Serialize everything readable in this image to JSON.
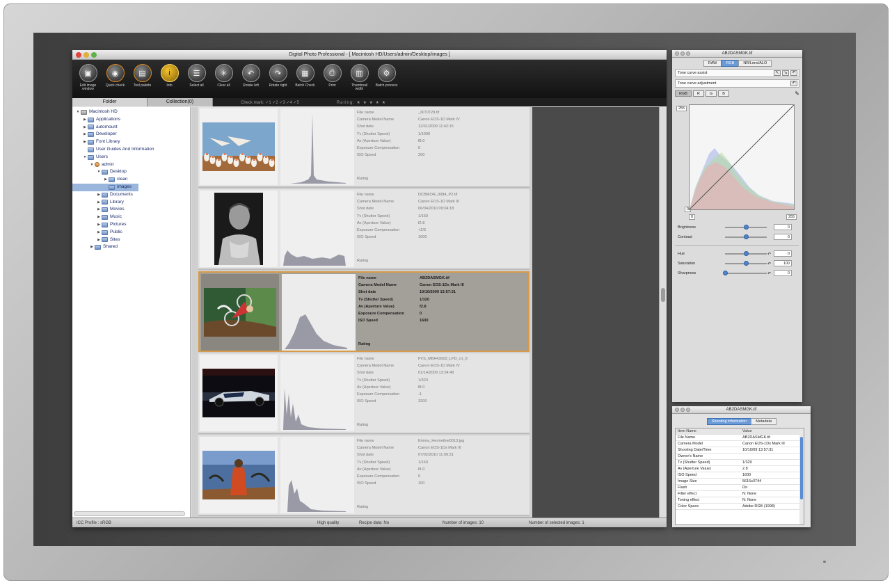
{
  "window": {
    "title": "Digital Photo Professional - [ Macintosh HD/Users/admin/Desktop/images ]"
  },
  "toolbar": [
    {
      "label": "Edit image window",
      "icon": "edit-window-icon",
      "glyph": "▣"
    },
    {
      "label": "Quick check",
      "icon": "quick-check-icon",
      "glyph": "◉"
    },
    {
      "label": "Tool palette",
      "icon": "tool-palette-icon",
      "glyph": "▤"
    },
    {
      "label": "Info",
      "icon": "info-icon",
      "glyph": "i"
    },
    {
      "label": "Select all",
      "icon": "select-all-icon",
      "glyph": "☰"
    },
    {
      "label": "Clear all",
      "icon": "clear-all-icon",
      "glyph": "✳"
    },
    {
      "label": "Rotate left",
      "icon": "rotate-left-icon",
      "glyph": "↶"
    },
    {
      "label": "Rotate right",
      "icon": "rotate-right-icon",
      "glyph": "↷"
    },
    {
      "label": "Batch Check",
      "icon": "batch-check-icon",
      "glyph": "▦"
    },
    {
      "label": "Print",
      "icon": "print-icon",
      "glyph": "⎙"
    },
    {
      "label": "Thumbnail width",
      "icon": "thumbnail-icon",
      "glyph": "▥"
    },
    {
      "label": "Batch process",
      "icon": "batch-process-icon",
      "glyph": "⚙"
    }
  ],
  "tabs": {
    "folder": "Folder",
    "collection": "Collection(0)"
  },
  "filter_bar": {
    "check_mark": "Check mark: ✓1 ✓2 ✓3 ✓4 ✓5",
    "rating": "Rating: ★ ★ ★ ★ ★"
  },
  "tree": [
    {
      "label": "Macintosh HD",
      "depth": 0,
      "kind": "hd",
      "open": true
    },
    {
      "label": "Applications",
      "depth": 1,
      "kind": "folder",
      "open": false
    },
    {
      "label": "automount",
      "depth": 1,
      "kind": "folder",
      "open": false
    },
    {
      "label": "Developer",
      "depth": 1,
      "kind": "folder",
      "open": false
    },
    {
      "label": "Font Library",
      "depth": 1,
      "kind": "folder",
      "open": false
    },
    {
      "label": "User Guides And Information",
      "depth": 1,
      "kind": "folder",
      "open": null
    },
    {
      "label": "Users",
      "depth": 1,
      "kind": "folder",
      "open": true
    },
    {
      "label": "admin",
      "depth": 2,
      "kind": "user",
      "open": true
    },
    {
      "label": "Desktop",
      "depth": 3,
      "kind": "folder",
      "open": true
    },
    {
      "label": "clean",
      "depth": 4,
      "kind": "folder",
      "open": false
    },
    {
      "label": "images",
      "depth": 4,
      "kind": "folder",
      "open": null,
      "selected": true
    },
    {
      "label": "Documents",
      "depth": 3,
      "kind": "folder",
      "open": false
    },
    {
      "label": "Library",
      "depth": 3,
      "kind": "folder",
      "open": false
    },
    {
      "label": "Movies",
      "depth": 3,
      "kind": "folder",
      "open": false
    },
    {
      "label": "Music",
      "depth": 3,
      "kind": "folder",
      "open": false
    },
    {
      "label": "Pictures",
      "depth": 3,
      "kind": "folder",
      "open": false
    },
    {
      "label": "Public",
      "depth": 3,
      "kind": "folder",
      "open": false
    },
    {
      "label": "Sites",
      "depth": 3,
      "kind": "folder",
      "open": false
    },
    {
      "label": "Shared",
      "depth": 2,
      "kind": "folder",
      "open": false
    }
  ],
  "info_keys": [
    "File name",
    "Camera Model Name",
    "Shot date",
    "Tv (Shutter Speed)",
    "Av (Aperture Value)",
    "Exposure Compensation",
    "ISO Speed"
  ],
  "rating_label": "Rating",
  "images": [
    {
      "values": [
        "_IKT0729.tif",
        "Canon EOS-1D Mark IV",
        "12/31/2009 11:42:15",
        "1/1000",
        "f8.0",
        "0",
        "200"
      ],
      "thumb": "birds",
      "hist": "spike",
      "selected": false
    },
    {
      "values": [
        "DCBMOR_0084_P2.tif",
        "Canon EOS-1D Mark III",
        "06/04/2010 09:04:18",
        "1/160",
        "f2.8",
        "+2/3",
        "1000"
      ],
      "thumb": "portrait",
      "hist": "low",
      "selected": false
    },
    {
      "values": [
        "AB2DASMGK.tif",
        "Canon EOS-1Ds Mark III",
        "10/10/2009 13:57:31",
        "1/320",
        "f2.8",
        "0",
        "1600"
      ],
      "thumb": "cyclist",
      "hist": "bump",
      "selected": true
    },
    {
      "values": [
        "FVS_MBA43003_LPD_v1_8",
        "Canon EOS-1D Mark IV",
        "01/14/2009 13:24:48",
        "1/320",
        "f8.0",
        "-1",
        "3200"
      ],
      "thumb": "racecar",
      "hist": "multi",
      "selected": false
    },
    {
      "values": [
        "Emma_Hermeline0013.jpg",
        "Canon EOS-1Ds Mark III",
        "07/02/2010 11:09:31",
        "1/160",
        "f4.0",
        "0",
        "100"
      ],
      "thumb": "person",
      "hist": "decay",
      "selected": false
    }
  ],
  "status": {
    "profile": "ICC Profile : sRGB",
    "quality": "High quality",
    "recipe": "Recipe data: No",
    "count": "Number of images: 10",
    "selected": "Number of selected images: 1"
  },
  "rgb_palette": {
    "title": "AB2DASMGK.tif",
    "tabs": [
      "RAW",
      "RGB",
      "NR/Lens/ALO"
    ],
    "active_tab": 1,
    "tone_curve": "Tone curve assist",
    "tone_adj": "Tone curve adjustment",
    "channels": [
      "RGB",
      "R",
      "G",
      "B"
    ],
    "curve_max": "255",
    "curve_min": "0",
    "in_min": "0",
    "in_max": "255",
    "sliders": [
      {
        "label": "Brightness",
        "value": "0",
        "level": 0.5,
        "group": 1
      },
      {
        "label": "Contrast",
        "value": "0",
        "level": 0.5,
        "group": 1
      },
      {
        "label": "Hue",
        "value": "0",
        "level": 0.5,
        "group": 2
      },
      {
        "label": "Saturation",
        "value": "100",
        "level": 0.5,
        "group": 2
      },
      {
        "label": "Sharpness",
        "value": "0",
        "level": 0.0,
        "group": 2
      }
    ]
  },
  "info_palette": {
    "title": "AB2DASMGK.tif",
    "tabs": [
      "Shooting information",
      "Metadata"
    ],
    "columns": [
      "Item Name",
      "Value"
    ],
    "rows": [
      [
        "File Name",
        "AB2DASMGK.tif"
      ],
      [
        "Camera Model",
        "Canon EOS-1Ds Mark III"
      ],
      [
        "Shooting Date/Time",
        "10/10/09 13:57:31"
      ],
      [
        "Owner's Name",
        ""
      ],
      [
        "Tv (Shutter Speed)",
        "1/320"
      ],
      [
        "Av (Aperture Value)",
        "2.8"
      ],
      [
        "ISO Speed",
        "1600"
      ],
      [
        "Image Size",
        "5616x3744"
      ],
      [
        "Flash",
        "On"
      ],
      [
        "Filter effect",
        "N: None"
      ],
      [
        "Toning effect",
        "N: None"
      ],
      [
        "Color Space",
        "Adobe RGB (1998)"
      ]
    ]
  },
  "colors": {
    "selection_border": "#d79b4a",
    "accent": "#6b9ad8"
  }
}
